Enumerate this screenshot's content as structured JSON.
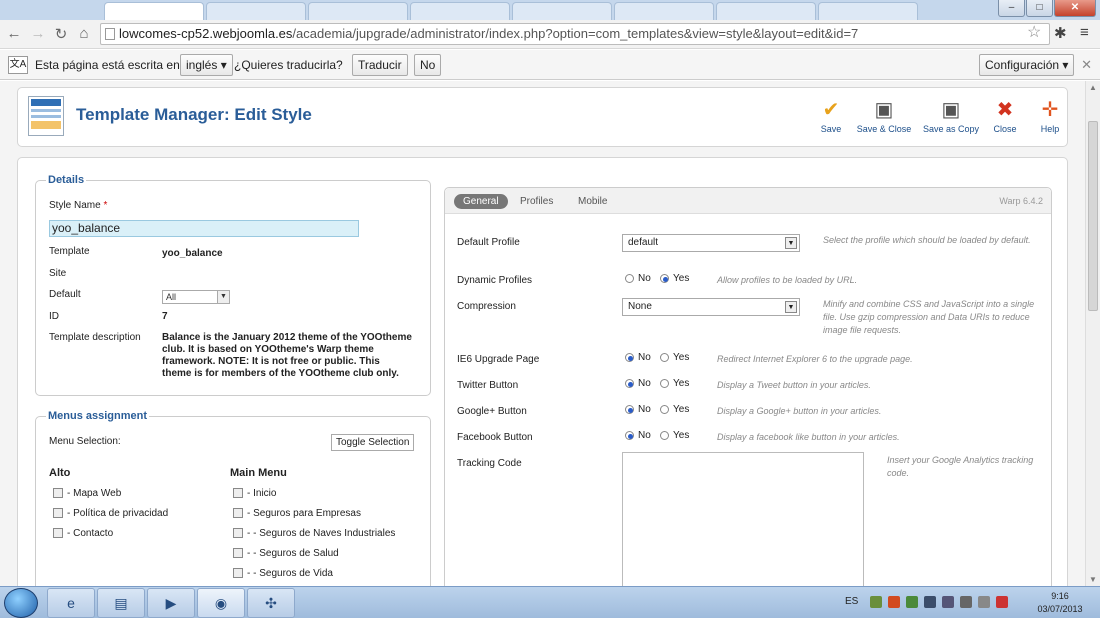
{
  "browser": {
    "url_host": "lowcomes-cp52.webjoomla.es",
    "url_path": "/academia/jupgrade/administrator/index.php?option=com_templates&view=style&layout=edit&id=7"
  },
  "translate_bar": {
    "message": "Esta página está escrita en",
    "language": "inglés",
    "question": "¿Quieres traducirla?",
    "translate_btn": "Traducir",
    "no_btn": "No",
    "settings_btn": "Configuración"
  },
  "header": {
    "title": "Template Manager: Edit Style",
    "buttons": {
      "save": "Save",
      "save_close": "Save & Close",
      "save_copy": "Save as Copy",
      "close": "Close",
      "help": "Help"
    }
  },
  "details": {
    "legend": "Details",
    "style_name_label": "Style Name",
    "required_mark": "*",
    "style_name_value": "yoo_balance",
    "template_label": "Template",
    "template_value": "yoo_balance",
    "site_label": "Site",
    "default_label": "Default",
    "default_value": "All",
    "id_label": "ID",
    "id_value": "7",
    "desc_label": "Template description",
    "desc_value": "Balance is the January 2012 theme of the YOOtheme club. It is based on YOOtheme's Warp theme framework. NOTE: It is not free or public. This theme is for members of the YOOtheme club only."
  },
  "menus": {
    "legend": "Menus assignment",
    "selection_label": "Menu Selection:",
    "toggle_btn": "Toggle Selection",
    "col1_title": "Alto",
    "col1_items": [
      "- Mapa Web",
      "- Política de privacidad",
      "- Contacto"
    ],
    "col2_title": "Main Menu",
    "col2_items": [
      "- Inicio",
      "- Seguros para Empresas",
      "- - Seguros de Naves Industriales",
      "- - Seguros de Salud",
      "- - Seguros de Vida"
    ]
  },
  "params": {
    "tabs": [
      "General",
      "Profiles",
      "Mobile"
    ],
    "version": "Warp 6.4.2",
    "no": "No",
    "yes": "Yes",
    "default_profile": {
      "label": "Default Profile",
      "value": "default",
      "hint": "Select the profile which should be loaded by default."
    },
    "dynamic_profiles": {
      "label": "Dynamic Profiles",
      "hint": "Allow profiles to be loaded by URL."
    },
    "compression": {
      "label": "Compression",
      "value": "None",
      "hint": "Minify and combine CSS and JavaScript into a single file. Use gzip compression and Data URIs to reduce image file requests."
    },
    "ie6": {
      "label": "IE6 Upgrade Page",
      "hint": "Redirect Internet Explorer 6 to the upgrade page."
    },
    "twitter": {
      "label": "Twitter Button",
      "hint": "Display a Tweet button in your articles."
    },
    "googleplus": {
      "label": "Google+ Button",
      "hint": "Display a Google+ button in your articles."
    },
    "facebook": {
      "label": "Facebook Button",
      "hint": "Display a facebook like button in your articles."
    },
    "tracking": {
      "label": "Tracking Code",
      "hint": "Insert your Google Analytics tracking code."
    }
  },
  "taskbar": {
    "lang": "ES",
    "time": "9:16",
    "date": "03/07/2013"
  }
}
